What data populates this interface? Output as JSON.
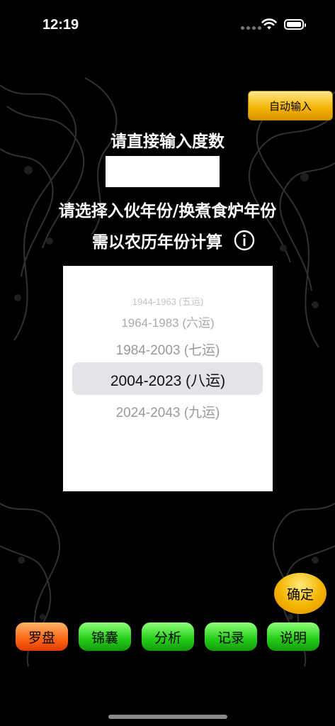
{
  "status": {
    "time": "12:19"
  },
  "header": {
    "auto_input_label": "自动输入"
  },
  "form": {
    "degree_prompt": "请直接输入度数",
    "degree_value": "",
    "year_prompt": "请选择入伙年份/换煮食炉年份",
    "lunar_note": "需以农历年份计算"
  },
  "picker": {
    "options": [
      "1944-1963 (五运)",
      "1964-1983 (六运)",
      "1984-2003 (七运)",
      "2004-2023 (八运)",
      "2024-2043 (九运)"
    ],
    "selected": "2004-2023 (八运)"
  },
  "actions": {
    "confirm_label": "确定"
  },
  "tabs": [
    {
      "label": "罗盘",
      "state": "active"
    },
    {
      "label": "锦囊"
    },
    {
      "label": "分析"
    },
    {
      "label": "记录"
    },
    {
      "label": "说明"
    }
  ],
  "colors": {
    "accent_gold": "#f4b400",
    "tab_green": "#2ad11c",
    "tab_active": "#ff6a1a"
  },
  "icons": [
    "wifi-icon",
    "battery-icon",
    "info-icon",
    "dragon-background"
  ]
}
